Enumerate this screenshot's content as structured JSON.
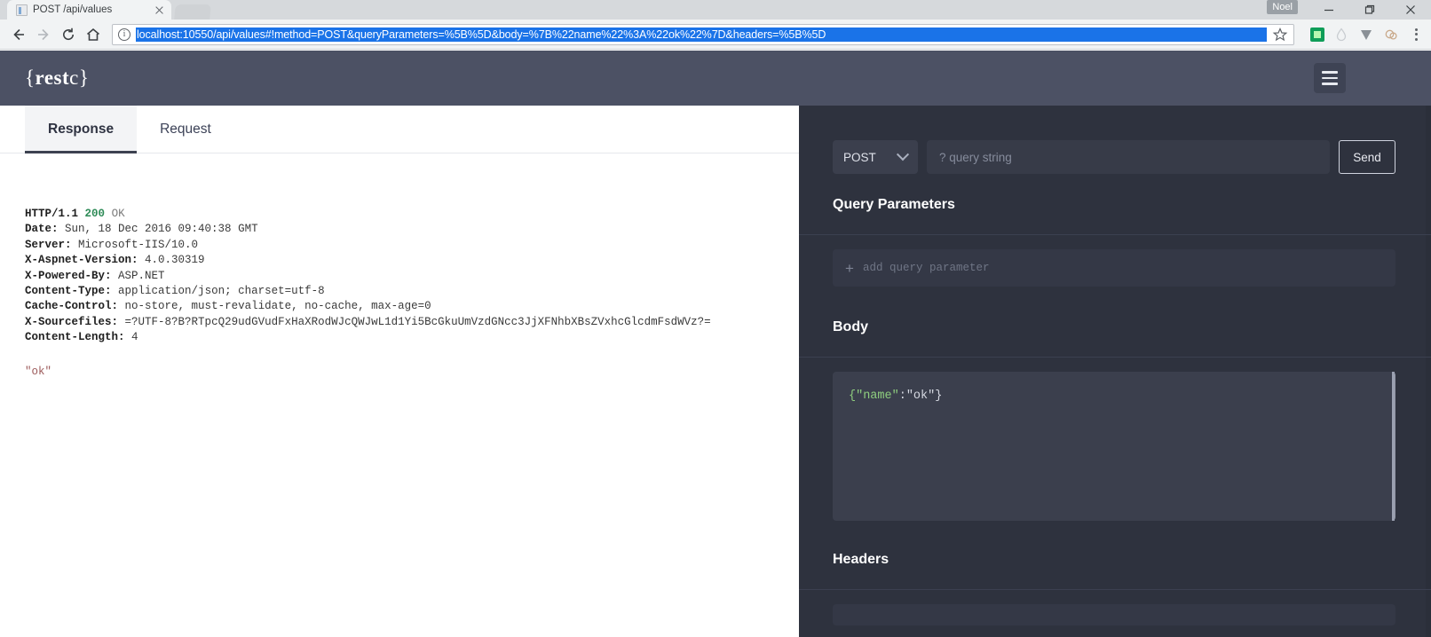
{
  "browser": {
    "tab": {
      "title": "POST /api/values",
      "favicon_icon": "page-icon",
      "close_icon": "close-icon"
    },
    "new_tab_icon": "new-tab-icon",
    "user_chip": "Noel",
    "window_controls": {
      "minimize": "minimize-icon",
      "maximize": "maximize-icon",
      "close": "close-icon"
    },
    "nav": {
      "back_icon": "back-arrow-icon",
      "forward_icon": "forward-arrow-icon",
      "reload_icon": "reload-icon",
      "home_icon": "home-icon"
    },
    "omnibox": {
      "info_icon": "info-circle-icon",
      "url": "localhost:10550/api/values#!method=POST&queryParameters=%5B%5D&body=%7B%22name%22%3A%22ok%22%7D&headers=%5B%5D",
      "star_icon": "bookmark-star-icon"
    },
    "extensions": [
      "green-square-extension-icon",
      "droplet-extension-icon",
      "v-extension-icon",
      "cloud-extension-icon"
    ],
    "menu_icon": "kebab-menu-icon"
  },
  "app": {
    "brand": {
      "left_brace": "{",
      "name_bold": "rest",
      "name_light": "c",
      "right_brace": "}"
    },
    "menu_icon": "hamburger-menu-icon"
  },
  "response_panel": {
    "tabs": [
      {
        "label": "Response",
        "active": true
      },
      {
        "label": "Request",
        "active": false
      }
    ],
    "status_line": {
      "protocol": "HTTP/1.1",
      "code": "200",
      "text": "OK"
    },
    "headers": [
      {
        "key": "Date:",
        "value": "Sun, 18 Dec 2016 09:40:38 GMT"
      },
      {
        "key": "Server:",
        "value": "Microsoft-IIS/10.0"
      },
      {
        "key": "X-Aspnet-Version:",
        "value": "4.0.30319"
      },
      {
        "key": "X-Powered-By:",
        "value": "ASP.NET"
      },
      {
        "key": "Content-Type:",
        "value": "application/json; charset=utf-8"
      },
      {
        "key": "Cache-Control:",
        "value": "no-store, must-revalidate, no-cache, max-age=0"
      },
      {
        "key": "X-Sourcefiles:",
        "value": "=?UTF-8?B?RTpcQ29udGVudFxHaXRodWJcQWJwL1d1Yi5BcGkuUmVzdGNcc3JjXFNhbXBsZVxhcGlcdmFsdWVz?="
      },
      {
        "key": "Content-Length:",
        "value": "4"
      }
    ],
    "payload": "\"ok\""
  },
  "request_panel": {
    "method": {
      "value": "POST",
      "chevron_icon": "chevron-down-icon"
    },
    "query_string": {
      "value": "",
      "placeholder": "? query string"
    },
    "send_label": "Send",
    "sections": {
      "query_parameters": {
        "title": "Query Parameters",
        "add_row": {
          "plus_icon": "plus-icon",
          "label": "add query parameter"
        }
      },
      "body": {
        "title": "Body",
        "code_key": "{\"name\"",
        "code_rest": ":\"ok\"}"
      },
      "headers": {
        "title": "Headers"
      }
    }
  },
  "colors": {
    "appbar": "#4c5164",
    "panel_bg": "#2e323e",
    "accent_green": "#8fce7f",
    "status_green": "#2e8b57",
    "url_highlight": "#1a73e8"
  }
}
